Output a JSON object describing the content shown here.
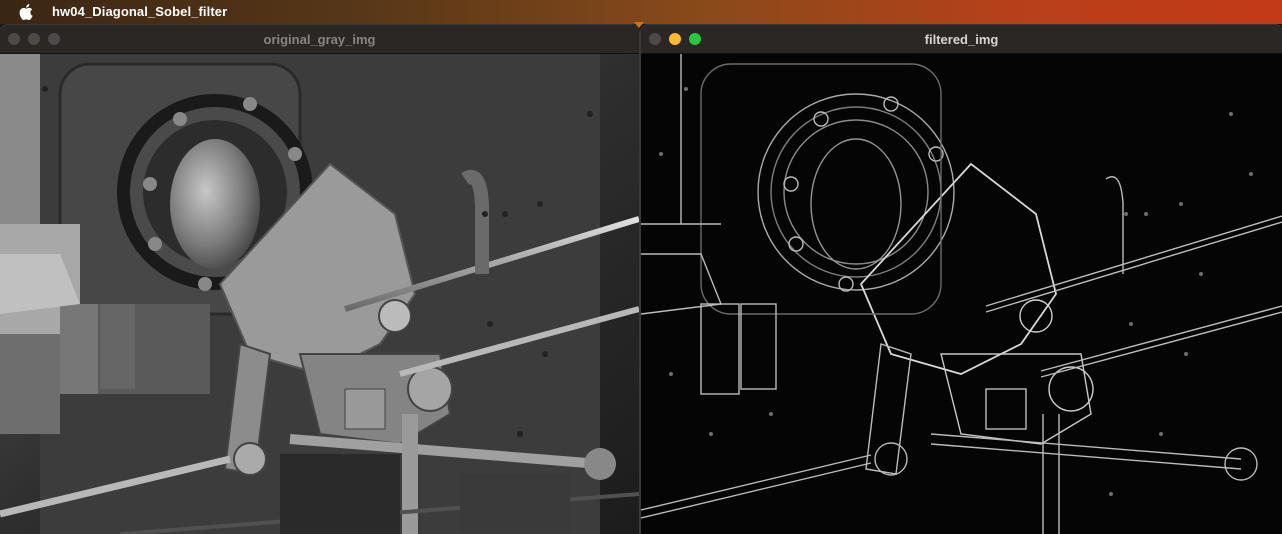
{
  "menubar": {
    "app_icon": "apple-logo-icon",
    "app_name": "hw04_Diagonal_Sobel_filter"
  },
  "windows": [
    {
      "title": "original_gray_img",
      "image_content": "grayscale photo of steam engine machinery",
      "controls": [
        "close-icon",
        "minimize-icon",
        "zoom-icon"
      ]
    },
    {
      "title": "filtered_img",
      "image_content": "diagonal Sobel edge-detection output",
      "controls": [
        "close-icon",
        "minimize-icon",
        "zoom-icon"
      ]
    }
  ],
  "colors": {
    "menubar_gradient_start": "#3a2614",
    "menubar_gradient_end": "#c33a17",
    "titlebar_bg": "#2b2725",
    "close": "#4d4948",
    "minimize_active": "#fdbc2e",
    "zoom_active": "#28c840"
  }
}
